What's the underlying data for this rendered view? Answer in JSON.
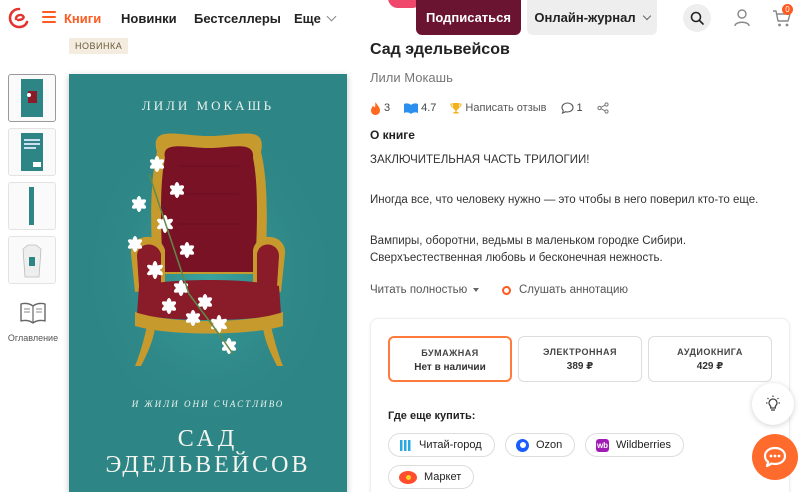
{
  "header": {
    "nav_books": "Книги",
    "nav_new": "Новинки",
    "nav_bestsellers": "Бестселлеры",
    "nav_more": "Еще",
    "subscribe": "Подписаться",
    "journal": "Онлайн-журнал",
    "cart_count": "0",
    "accent_color": "#ff5a1f",
    "subscribe_color": "#6b1432"
  },
  "sidebar": {
    "toc_label": "Оглавление"
  },
  "badge": "НОВИНКА",
  "cover": {
    "author": "ЛИЛИ МОКАШЬ",
    "tagline": "И ЖИЛИ ОНИ СЧАСТЛИВО",
    "title_line1": "САД",
    "title_line2": "ЭДЕЛЬВЕЙСОВ",
    "bg_color": "#2e8585"
  },
  "book": {
    "title": "Сад эдельвейсов",
    "author": "Лили Мокашь",
    "fire_count": "3",
    "rating": "4.7",
    "write_review": "Написать отзыв",
    "comments": "1",
    "about_heading": "О книге",
    "para1": "ЗАКЛЮЧИТЕЛЬНАЯ ЧАСТЬ ТРИЛОГИИ!",
    "para2": "Иногда все, что человеку нужно — это чтобы в него поверил кто-то еще.",
    "para3_line1": "Вампиры, оборотни, ведьмы в маленьком городке Сибири.",
    "para3_line2": "Сверхъестественная любовь и бесконечная нежность.",
    "read_more": "Читать полностью",
    "listen": "Слушать аннотацию"
  },
  "formats": [
    {
      "label": "БУМАЖНАЯ",
      "value": "Нет в наличии"
    },
    {
      "label": "ЭЛЕКТРОННАЯ",
      "value": "389 ₽"
    },
    {
      "label": "АУДИОКНИГА",
      "value": "429 ₽"
    }
  ],
  "where_to_buy": {
    "heading": "Где еще купить:",
    "shops": [
      "Читай-город",
      "Ozon",
      "Wildberries",
      "Маркет"
    ]
  }
}
